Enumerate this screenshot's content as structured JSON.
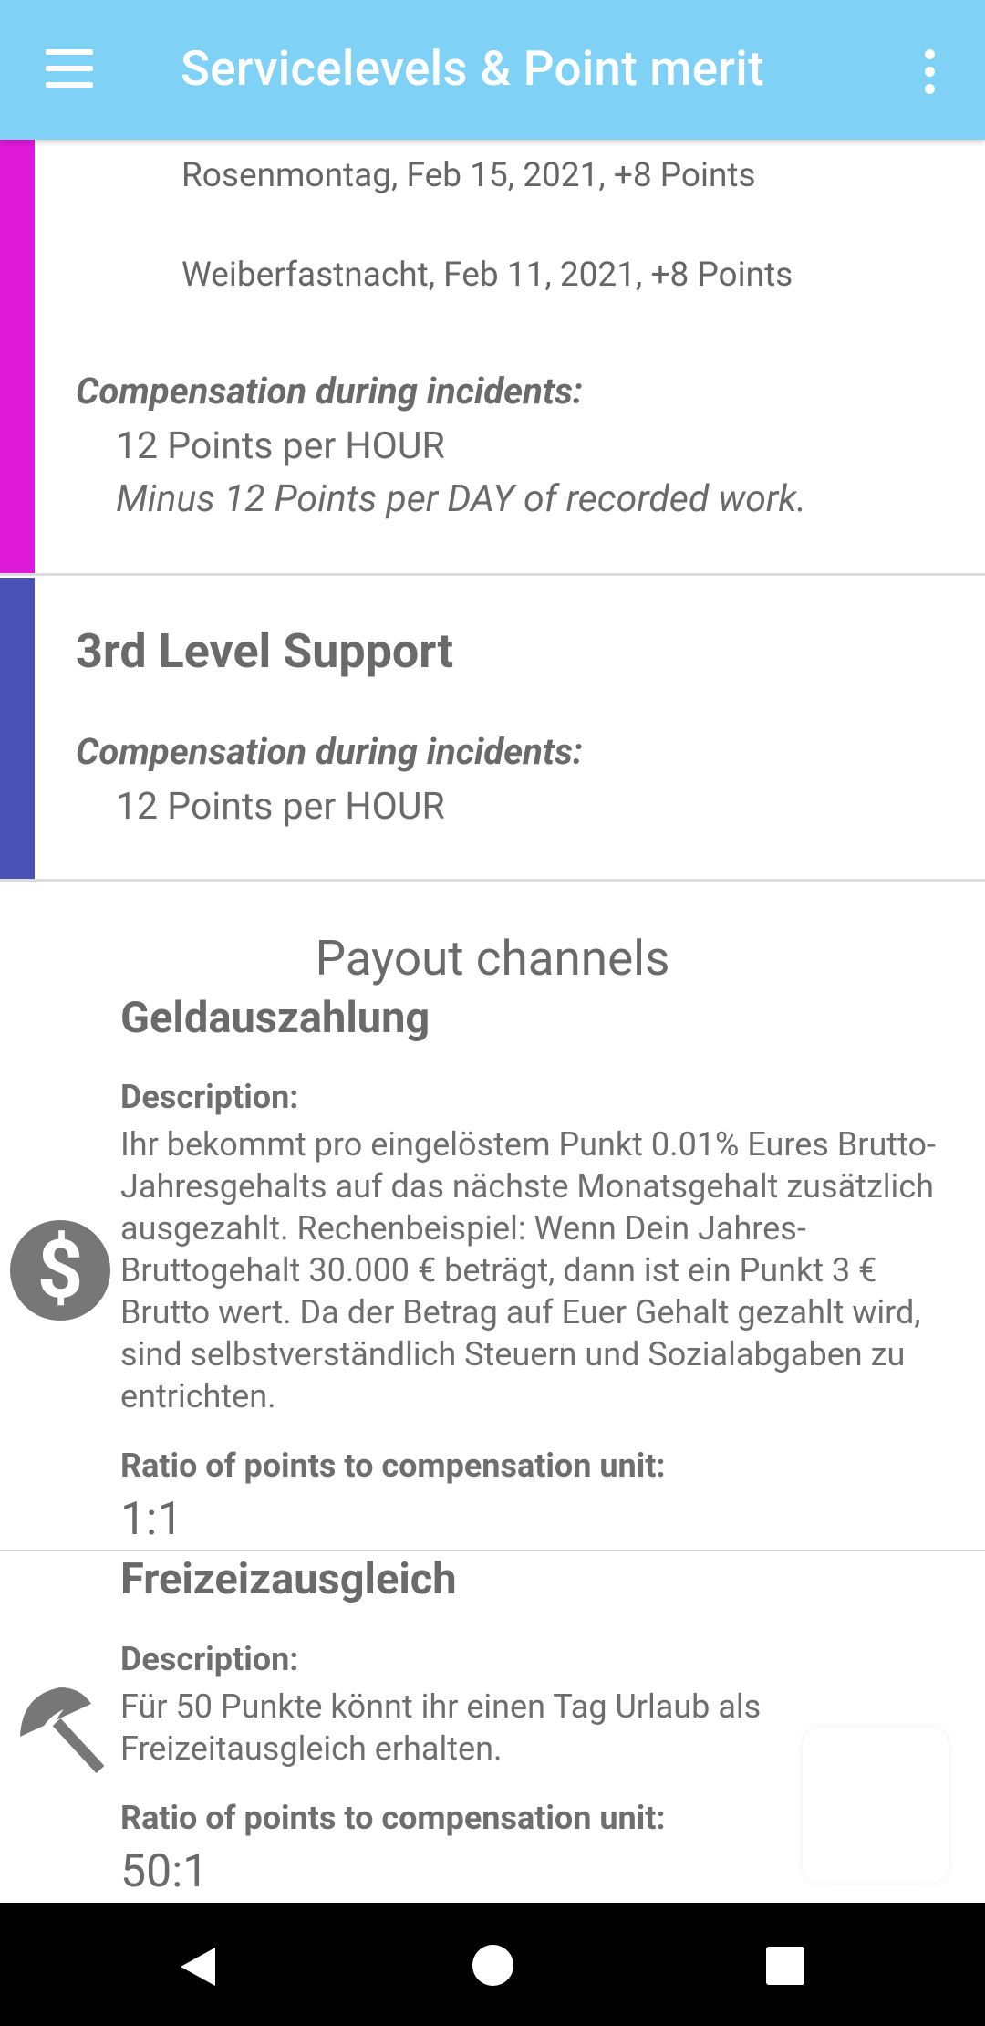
{
  "app_bar": {
    "title": "Servicelevels & Point merit",
    "menu_icon": "hamburger-menu-icon",
    "overflow_icon": "more-vert-icon",
    "color": "#7fd1f5"
  },
  "levels": [
    {
      "stripe_color": "#df19d8",
      "holidays": [
        "Rosenmontag, Feb 15, 2021, +8 Points",
        "Weiberfastnacht, Feb 11, 2021, +8 Points"
      ],
      "compensation_label": "Compensation during incidents:",
      "compensation_lines": [
        "12 Points per HOUR",
        "Minus 12 Points per DAY of recorded work."
      ]
    },
    {
      "stripe_color": "#4a52b5",
      "title": "3rd Level Support",
      "compensation_label": "Compensation during incidents:",
      "compensation_lines": [
        "12 Points per HOUR"
      ]
    }
  ],
  "payout": {
    "heading": "Payout channels",
    "channels": [
      {
        "icon": "dollar-icon",
        "title": "Geldauszahlung",
        "description_label": "Description:",
        "description": "Ihr bekommt pro eingelöstem Punkt 0.01% Eures Brutto-Jahresgehalts auf das nächste Monatsgehalt zusätzlich ausgezahlt. Rechenbeispiel: Wenn Dein Jahres-Bruttogehalt 30.000 € beträgt, dann ist ein Punkt 3 € Brutto wert. Da der Betrag auf Euer Gehalt gezahlt wird, sind selbstverständlich Steuern und Sozialabgaben zu entrichten.",
        "ratio_label": "Ratio of points to compensation unit:",
        "ratio": "1:1"
      },
      {
        "icon": "beach-umbrella-icon",
        "title": "Freizeizausgleich",
        "description_label": "Description:",
        "description": "Für 50 Punkte könnt ihr einen Tag Urlaub als Freizeitausgleich erhalten.",
        "ratio_label": "Ratio of points to compensation unit:",
        "ratio": "50:1"
      }
    ]
  },
  "nav_bar": {
    "back_icon": "back-triangle-icon",
    "home_icon": "home-circle-icon",
    "recents_icon": "recents-square-icon"
  }
}
